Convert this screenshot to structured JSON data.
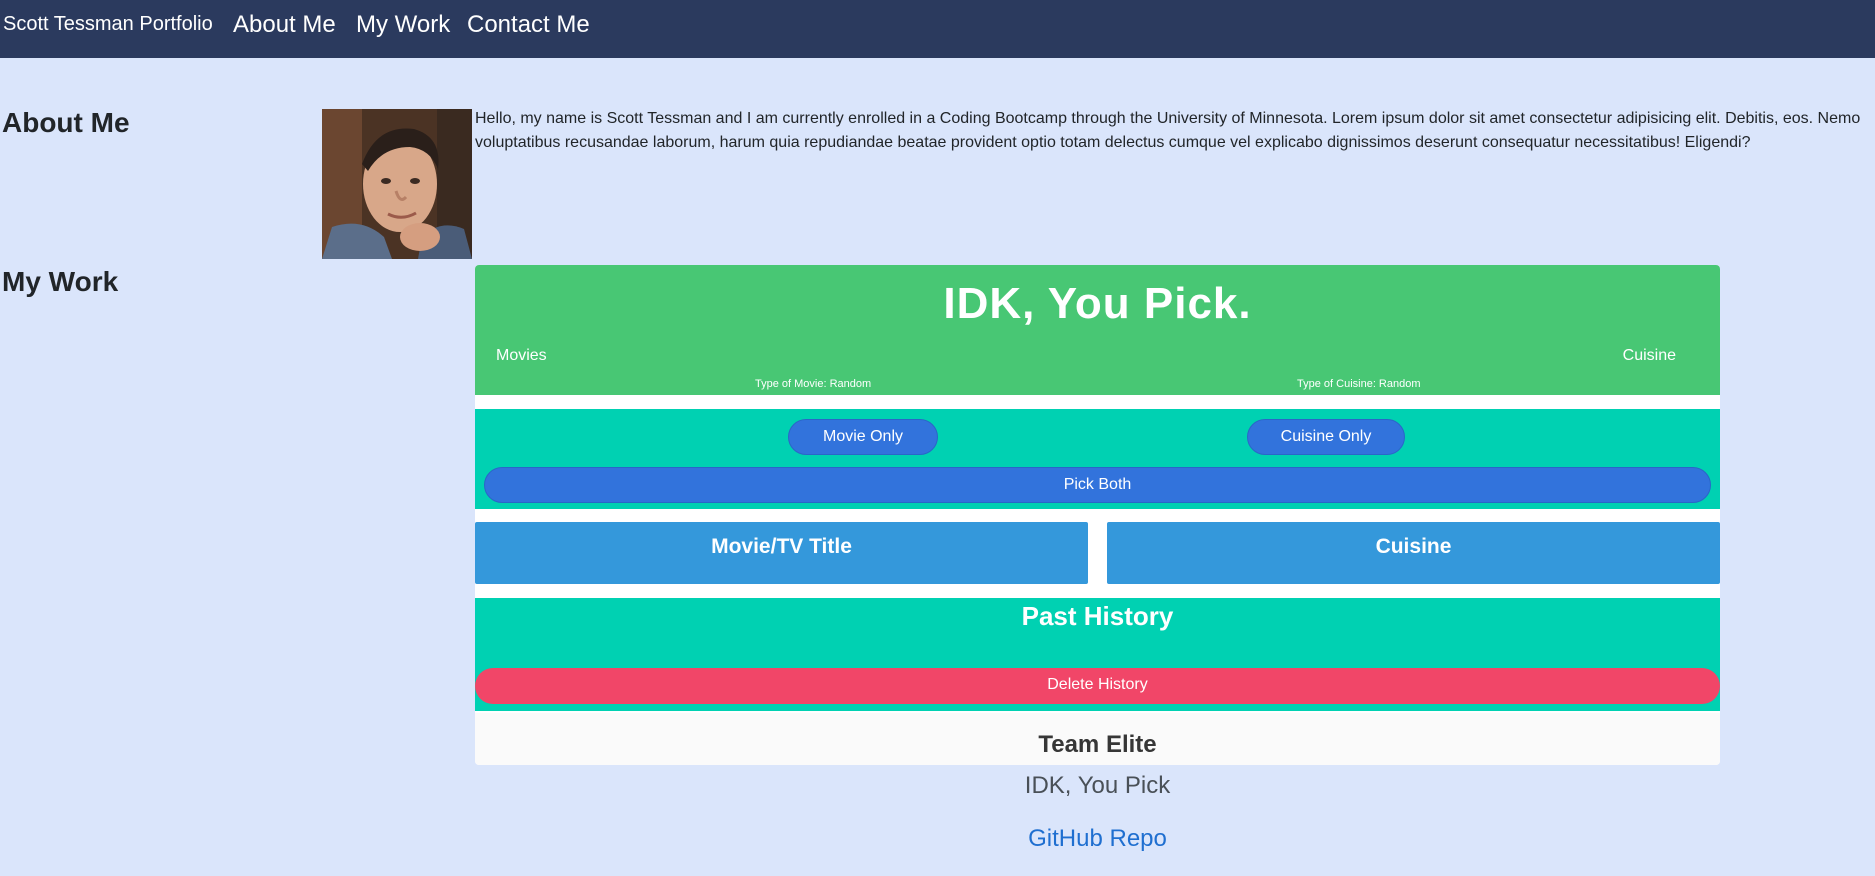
{
  "navbar": {
    "brand": "Scott Tessman Portfolio",
    "links": [
      "About Me",
      "My Work",
      "Contact Me"
    ]
  },
  "about": {
    "title": "About Me",
    "text": "Hello, my name is Scott Tessman and I am currently enrolled in a Coding Bootcamp through the University of Minnesota. Lorem ipsum dolor sit amet consectetur adipisicing elit. Debitis, eos. Nemo voluptatibus recusandae laborum, harum quia repudiandae beatae provident optio totam delectus cumque vel explicabo dignissimos deserunt consequatur necessitatibus! Eligendi?"
  },
  "work": {
    "title": "My Work",
    "project": {
      "app_title": "IDK, You Pick.",
      "movies_label": "Movies",
      "cuisine_label": "Cuisine",
      "movie_type": "Type of Movie: Random",
      "cuisine_type": "Type of Cuisine: Random",
      "movie_only_button": "Movie Only",
      "cuisine_only_button": "Cuisine Only",
      "pick_both_button": "Pick Both",
      "movie_result_label": "Movie/TV Title",
      "cuisine_result_label": "Cuisine",
      "history_title": "Past History",
      "delete_history_button": "Delete History",
      "team_name": "Team Elite",
      "caption": "IDK, You Pick",
      "repo_link": "GitHub Repo"
    }
  },
  "colors": {
    "navbar": "#2b3a5e",
    "page_background": "#dae5fb",
    "hero_green": "#48c774",
    "turquoise": "#00d1b2",
    "button_blue": "#3273dc",
    "result_blue": "#3498db",
    "danger": "#f14668",
    "link": "#1f6fd0"
  }
}
